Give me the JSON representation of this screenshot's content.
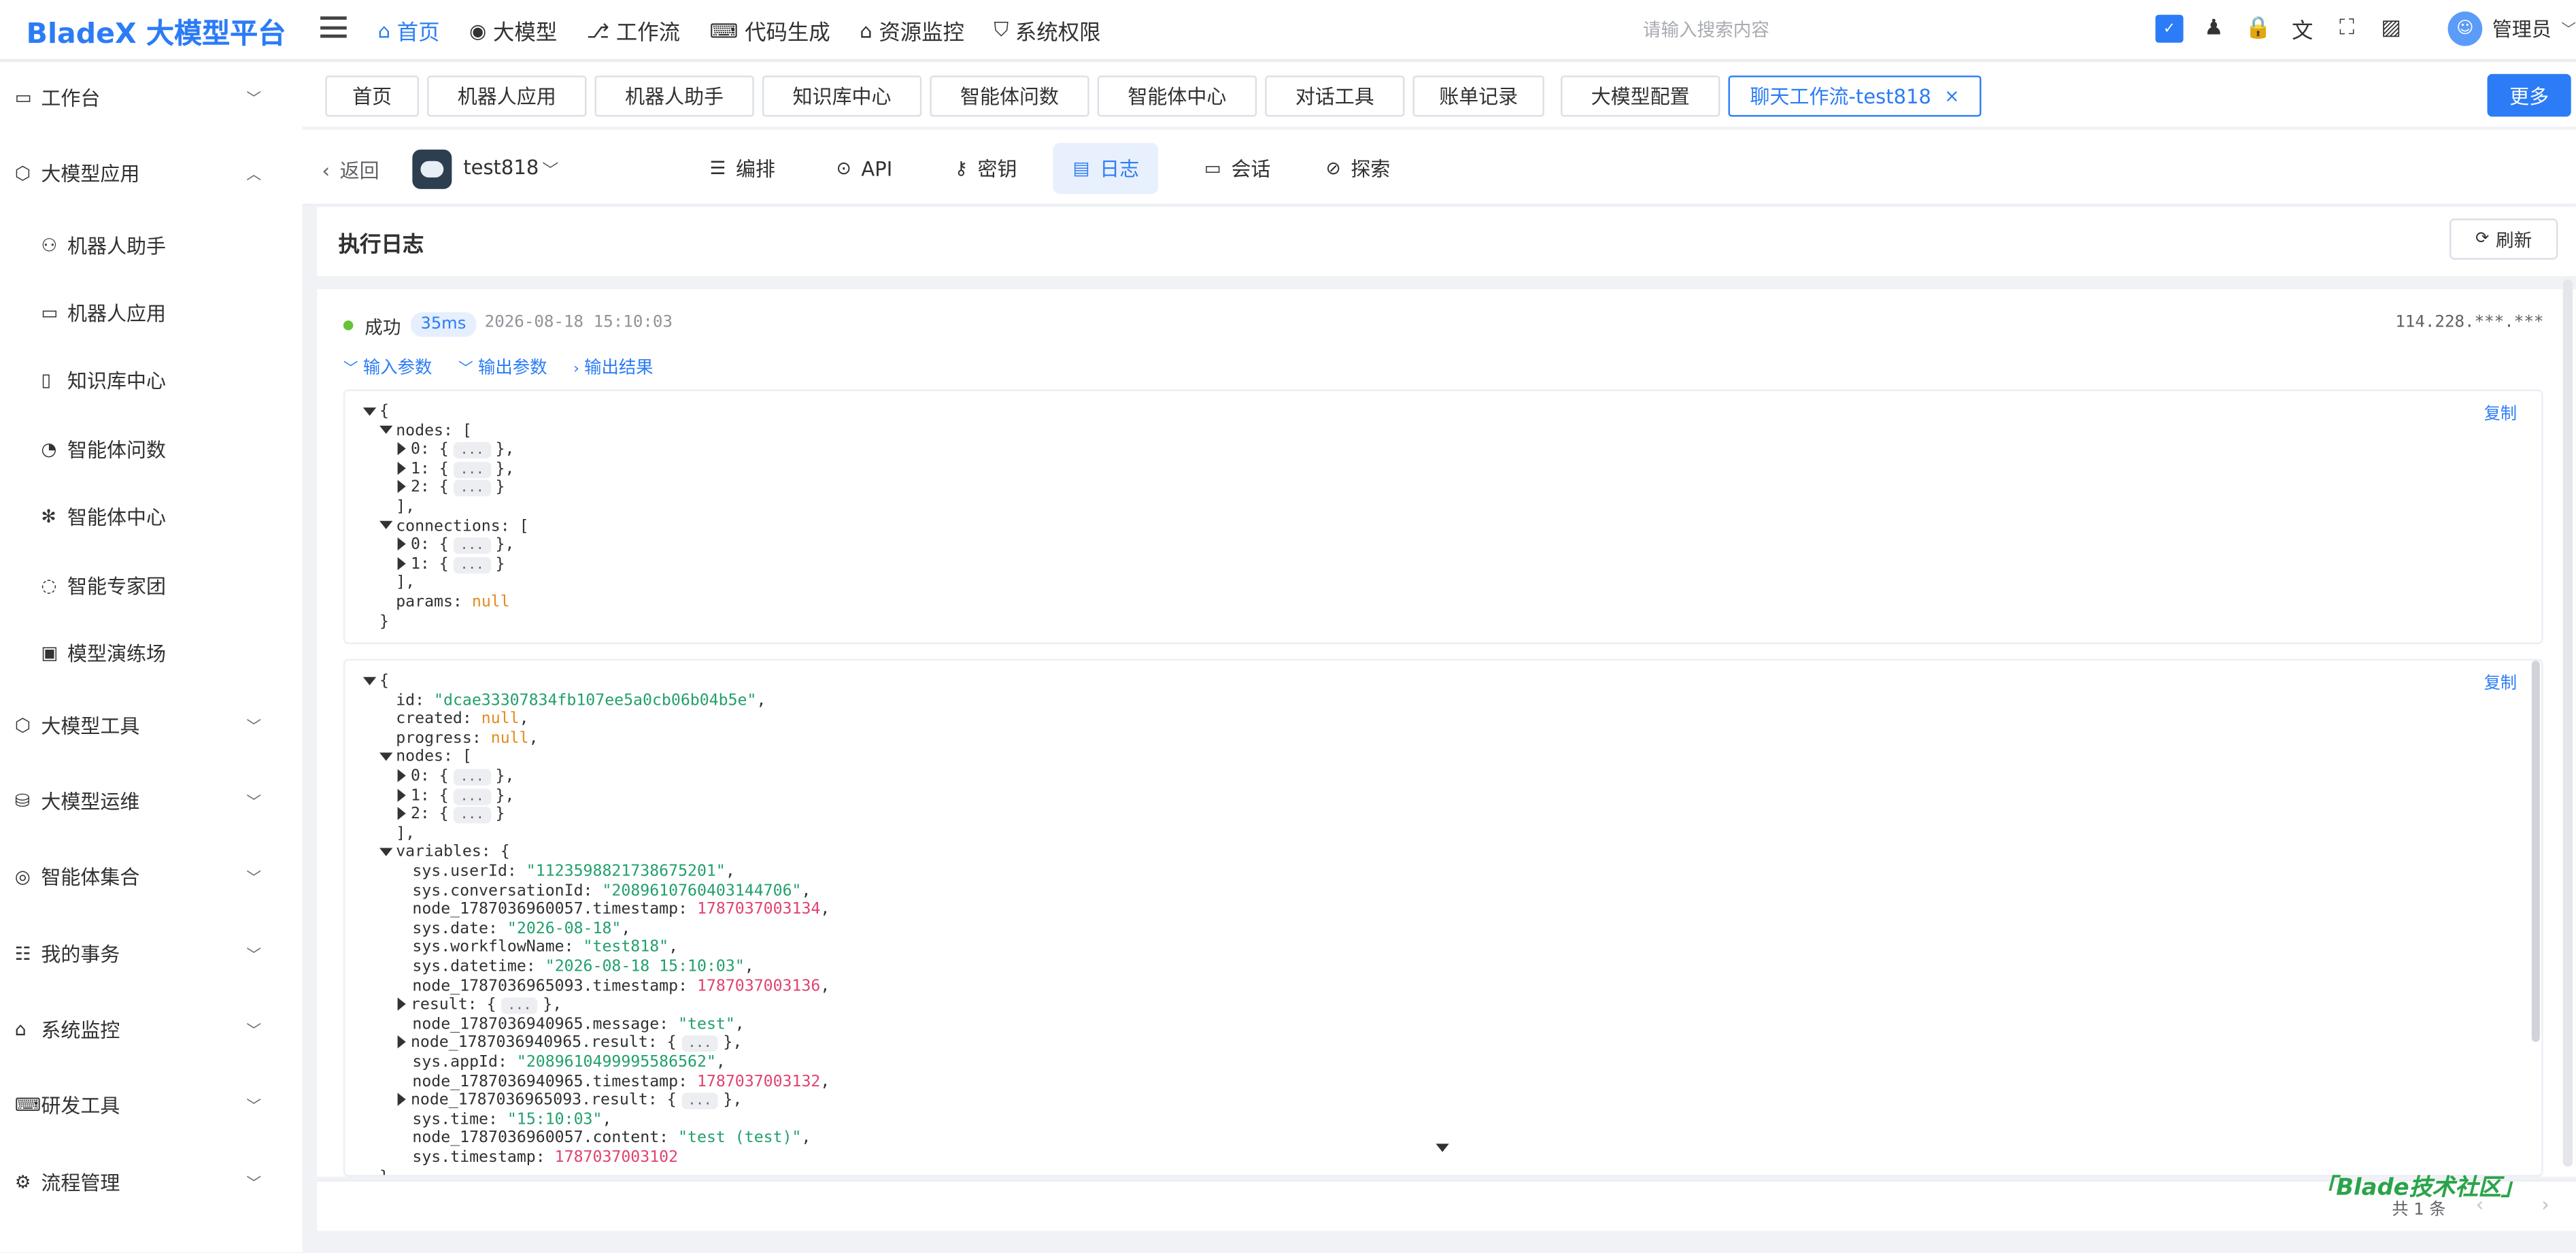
{
  "app": {
    "logo": "BladeX 大模型平台",
    "search_placeholder": "请输入搜索内容",
    "user": "管理员"
  },
  "topmenu": [
    {
      "label": "首页",
      "icon": "home-icon",
      "glyph": "⌂",
      "active": true
    },
    {
      "label": "大模型",
      "icon": "model-icon",
      "glyph": "◉"
    },
    {
      "label": "工作流",
      "icon": "workflow-icon",
      "glyph": "⎇"
    },
    {
      "label": "代码生成",
      "icon": "code-icon",
      "glyph": "⌨"
    },
    {
      "label": "资源监控",
      "icon": "monitor-icon",
      "glyph": "⌂"
    },
    {
      "label": "系统权限",
      "icon": "shield-icon",
      "glyph": "⛉"
    }
  ],
  "toolbar_icons": [
    {
      "name": "checkbox-icon",
      "glyph": "✓"
    },
    {
      "name": "shirt-icon",
      "glyph": "♟"
    },
    {
      "name": "lock-icon",
      "glyph": "🔒"
    },
    {
      "name": "translate-icon",
      "glyph": "文"
    },
    {
      "name": "fullscreen-icon",
      "glyph": "⛶"
    },
    {
      "name": "image-icon",
      "glyph": "▨"
    }
  ],
  "sidebar": [
    {
      "label": "工作台",
      "icon": "desktop-icon",
      "glyph": "▭",
      "arrow": "﹀",
      "sub": false
    },
    {
      "label": "大模型应用",
      "icon": "cube-icon",
      "glyph": "⬡",
      "arrow": "︿",
      "sub": false
    },
    {
      "label": "机器人助手",
      "icon": "user-icon",
      "glyph": "⚇",
      "sub": true
    },
    {
      "label": "机器人应用",
      "icon": "monitor-icon",
      "glyph": "▭",
      "sub": true
    },
    {
      "label": "知识库中心",
      "icon": "book-icon",
      "glyph": "▯",
      "sub": true
    },
    {
      "label": "智能体问数",
      "icon": "chat-data-icon",
      "glyph": "◔",
      "sub": true
    },
    {
      "label": "智能体中心",
      "icon": "agent-icon",
      "glyph": "✻",
      "sub": true
    },
    {
      "label": "智能专家团",
      "icon": "team-icon",
      "glyph": "◌",
      "sub": true
    },
    {
      "label": "模型演练场",
      "icon": "chip-icon",
      "glyph": "▣",
      "sub": true
    },
    {
      "label": "大模型工具",
      "icon": "cube-icon",
      "glyph": "⬡",
      "arrow": "﹀",
      "sub": false
    },
    {
      "label": "大模型运维",
      "icon": "ops-icon",
      "glyph": "⛁",
      "arrow": "﹀",
      "sub": false
    },
    {
      "label": "智能体集合",
      "icon": "agent-set-icon",
      "glyph": "◎",
      "arrow": "﹀",
      "sub": false
    },
    {
      "label": "我的事务",
      "icon": "task-icon",
      "glyph": "☷",
      "arrow": "﹀",
      "sub": false
    },
    {
      "label": "系统监控",
      "icon": "bank-icon",
      "glyph": "⌂",
      "arrow": "﹀",
      "sub": false
    },
    {
      "label": "研发工具",
      "icon": "code-icon",
      "glyph": "⌨",
      "arrow": "﹀",
      "sub": false
    },
    {
      "label": "流程管理",
      "icon": "flow-icon",
      "glyph": "⚙",
      "arrow": "﹀",
      "sub": false
    }
  ],
  "tabs": [
    "首页",
    "机器人应用",
    "机器人助手",
    "知识库中心",
    "智能体问数",
    "智能体中心",
    "对话工具",
    "账单记录",
    "大模型配置",
    "聊天工作流-test818"
  ],
  "more_label": "更多",
  "appbar": {
    "back": "返回",
    "app_name": "test818",
    "nav": [
      {
        "label": "编排",
        "icon": "sliders-icon",
        "glyph": "☰"
      },
      {
        "label": "API",
        "icon": "pin-icon",
        "glyph": "⊙"
      },
      {
        "label": "密钥",
        "icon": "key-icon",
        "glyph": "⚷"
      },
      {
        "label": "日志",
        "icon": "log-icon",
        "glyph": "▤",
        "active": true
      },
      {
        "label": "会话",
        "icon": "chat-icon",
        "glyph": "▭"
      },
      {
        "label": "探索",
        "icon": "compass-icon",
        "glyph": "⊘"
      }
    ]
  },
  "log": {
    "title": "执行日志",
    "refresh": "刷新",
    "status": "成功",
    "duration": "35ms",
    "timestamp": "2026-08-18 15:10:03",
    "ip": "114.228.***.***",
    "sections": [
      "输入参数",
      "输出参数",
      "输出结果"
    ],
    "copy": "复制",
    "total": "共 1 条"
  },
  "code1": [
    {
      "t": "{",
      "tri": "down"
    },
    {
      "t": "nodes: [",
      "ind": 1,
      "tri": "down"
    },
    {
      "t": "0: {",
      "ind": 2,
      "tri": "right",
      "ell": true,
      "after": "},"
    },
    {
      "t": "1: {",
      "ind": 2,
      "tri": "right",
      "ell": true,
      "after": "},"
    },
    {
      "t": "2: {",
      "ind": 2,
      "tri": "right",
      "ell": true,
      "after": "}"
    },
    {
      "t": "],",
      "ind": 1
    },
    {
      "t": "connections: [",
      "ind": 1,
      "tri": "down"
    },
    {
      "t": "0: {",
      "ind": 2,
      "tri": "right",
      "ell": true,
      "after": "},"
    },
    {
      "t": "1: {",
      "ind": 2,
      "tri": "right",
      "ell": true,
      "after": "}"
    },
    {
      "t": "],",
      "ind": 1
    },
    {
      "t": "params: ",
      "ind": 1,
      "v": "null",
      "vt": "nul"
    },
    {
      "t": "}"
    }
  ],
  "code2": [
    {
      "t": "{",
      "tri": "down"
    },
    {
      "t": "id: ",
      "ind": 1,
      "v": "\"dcae33307834fb107ee5a0cb06b04b5e\"",
      "vt": "str",
      "after": ","
    },
    {
      "t": "created: ",
      "ind": 1,
      "v": "null",
      "vt": "nul",
      "after": ","
    },
    {
      "t": "progress: ",
      "ind": 1,
      "v": "null",
      "vt": "nul",
      "after": ","
    },
    {
      "t": "nodes: [",
      "ind": 1,
      "tri": "down"
    },
    {
      "t": "0: {",
      "ind": 2,
      "tri": "right",
      "ell": true,
      "after": "},"
    },
    {
      "t": "1: {",
      "ind": 2,
      "tri": "right",
      "ell": true,
      "after": "},"
    },
    {
      "t": "2: {",
      "ind": 2,
      "tri": "right",
      "ell": true,
      "after": "}"
    },
    {
      "t": "],",
      "ind": 1
    },
    {
      "t": "variables: {",
      "ind": 1,
      "tri": "down"
    },
    {
      "t": "sys.userId: ",
      "ind": 2,
      "v": "\"1123598821738675201\"",
      "vt": "str",
      "after": ","
    },
    {
      "t": "sys.conversationId: ",
      "ind": 2,
      "v": "\"2089610760403144706\"",
      "vt": "str",
      "after": ","
    },
    {
      "t": "node_1787036960057.timestamp: ",
      "ind": 2,
      "v": "1787037003134",
      "vt": "num",
      "after": ","
    },
    {
      "t": "sys.date: ",
      "ind": 2,
      "v": "\"2026-08-18\"",
      "vt": "str",
      "after": ","
    },
    {
      "t": "sys.workflowName: ",
      "ind": 2,
      "v": "\"test818\"",
      "vt": "str",
      "after": ","
    },
    {
      "t": "sys.datetime: ",
      "ind": 2,
      "v": "\"2026-08-18 15:10:03\"",
      "vt": "str",
      "after": ","
    },
    {
      "t": "node_1787036965093.timestamp: ",
      "ind": 2,
      "v": "1787037003136",
      "vt": "num",
      "after": ","
    },
    {
      "t": "result: {",
      "ind": 2,
      "tri": "right",
      "ell": true,
      "after": "},"
    },
    {
      "t": "node_1787036940965.message: ",
      "ind": 2,
      "v": "\"test\"",
      "vt": "str",
      "after": ","
    },
    {
      "t": "node_1787036940965.result: {",
      "ind": 2,
      "tri": "right",
      "ell": true,
      "after": "},"
    },
    {
      "t": "sys.appId: ",
      "ind": 2,
      "v": "\"2089610499995586562\"",
      "vt": "str",
      "after": ","
    },
    {
      "t": "node_1787036940965.timestamp: ",
      "ind": 2,
      "v": "1787037003132",
      "vt": "num",
      "after": ","
    },
    {
      "t": "node_1787036965093.result: {",
      "ind": 2,
      "tri": "right",
      "ell": true,
      "after": "},"
    },
    {
      "t": "sys.time: ",
      "ind": 2,
      "v": "\"15:10:03\"",
      "vt": "str",
      "after": ","
    },
    {
      "t": "node_1787036960057.content: ",
      "ind": 2,
      "v": "\"test (test)\"",
      "vt": "str",
      "after": ","
    },
    {
      "t": "sys.timestamp: ",
      "ind": 2,
      "v": "1787037003102",
      "vt": "num"
    },
    {
      "t": "}",
      "ind": 0
    }
  ],
  "watermark": "「Blade技术社区」"
}
